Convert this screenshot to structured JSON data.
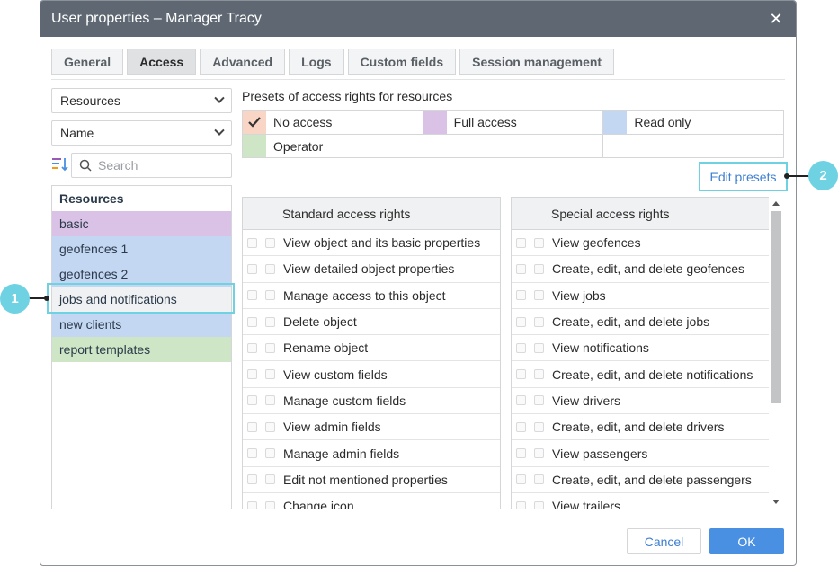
{
  "window": {
    "title": "User properties – Manager Tracy",
    "close_glyph": "✕"
  },
  "tabs": [
    {
      "label": "General",
      "active": false
    },
    {
      "label": "Access",
      "active": true
    },
    {
      "label": "Advanced",
      "active": false
    },
    {
      "label": "Logs",
      "active": false
    },
    {
      "label": "Custom fields",
      "active": false
    },
    {
      "label": "Session management",
      "active": false
    }
  ],
  "left": {
    "type_select": "Resources",
    "sort_select": "Name",
    "search_placeholder": "Search",
    "list_header": "Resources",
    "items": [
      {
        "label": "basic",
        "color": "#d9c2e6"
      },
      {
        "label": "geofences 1",
        "color": "#c3d7f2"
      },
      {
        "label": "geofences 2",
        "color": "#c3d7f2"
      },
      {
        "label": "jobs and notifications",
        "color": "#f0f1f2"
      },
      {
        "label": "new clients",
        "color": "#c3d7f2"
      },
      {
        "label": "report templates",
        "color": "#cfe6c6"
      }
    ]
  },
  "presets": {
    "title": "Presets of access rights for resources",
    "items": [
      {
        "label": "No access",
        "color": "#f9d5c6",
        "checked": true
      },
      {
        "label": "Full access",
        "color": "#d9c2e6",
        "checked": false
      },
      {
        "label": "Read only",
        "color": "#c3d7f2",
        "checked": false
      },
      {
        "label": "Operator",
        "color": "#cfe6c6",
        "checked": false
      }
    ],
    "edit_label": "Edit presets"
  },
  "standard": {
    "title": "Standard access rights",
    "rows": [
      "View object and its basic properties",
      "View detailed object properties",
      "Manage access to this object",
      "Delete object",
      "Rename object",
      "View custom fields",
      "Manage custom fields",
      "View admin fields",
      "Manage admin fields",
      "Edit not mentioned properties",
      "Change icon"
    ]
  },
  "special": {
    "title": "Special access rights",
    "rows": [
      "View geofences",
      "Create, edit, and delete geofences",
      "View jobs",
      "Create, edit, and delete jobs",
      "View notifications",
      "Create, edit, and delete notifications",
      "View drivers",
      "Create, edit, and delete drivers",
      "View passengers",
      "Create, edit, and delete passengers",
      "View trailers"
    ]
  },
  "buttons": {
    "cancel": "Cancel",
    "ok": "OK"
  },
  "callouts": {
    "one": "1",
    "two": "2"
  },
  "colors": {
    "accent": "#4a90e2",
    "callout": "#6fd2e3",
    "titlebar": "#5f6872"
  }
}
